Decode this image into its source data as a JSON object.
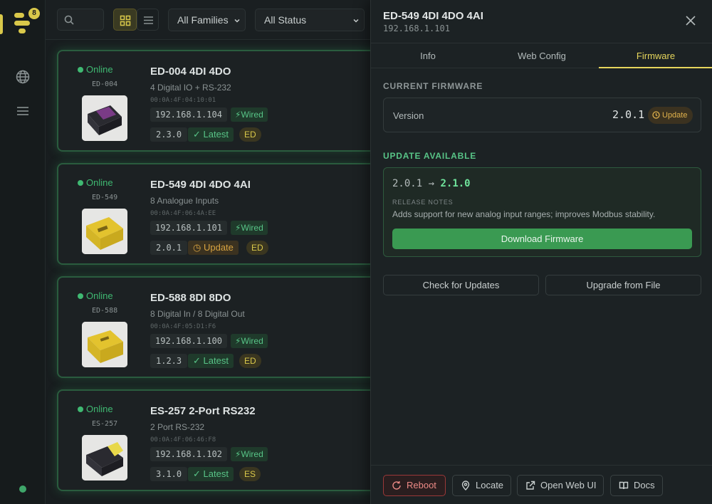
{
  "rail": {
    "badge_count": "8"
  },
  "toolbar": {
    "families_select": "All Families",
    "status_select": "All Status"
  },
  "devices": [
    {
      "status": "Online",
      "model": "ED-004",
      "name": "ED-004 4DI 4DO",
      "description": "4 Digital IO + RS-232",
      "mac": "00:0A:4F:04:10:01",
      "ip": "192.168.1.104",
      "connection": "Wired",
      "version": "2.3.0",
      "fw_state": "Latest",
      "family": "ED"
    },
    {
      "status": "Online",
      "model": "ED-549",
      "name": "ED-549 4DI 4DO 4AI",
      "description": "8 Analogue Inputs",
      "mac": "00:0A:4F:06:4A:EE",
      "ip": "192.168.1.101",
      "connection": "Wired",
      "version": "2.0.1",
      "fw_state": "Update",
      "family": "ED"
    },
    {
      "status": "Online",
      "model": "ED-588",
      "name": "ED-588 8DI 8DO",
      "description": "8 Digital In / 8 Digital Out",
      "mac": "00:0A:4F:05:D1:F6",
      "ip": "192.168.1.100",
      "connection": "Wired",
      "version": "1.2.3",
      "fw_state": "Latest",
      "family": "ED"
    },
    {
      "status": "Online",
      "model": "ES-257",
      "name": "ES-257 2-Port RS232",
      "description": "2 Port RS-232",
      "mac": "00:0A:4F:06:46:F8",
      "ip": "192.168.1.102",
      "connection": "Wired",
      "version": "3.1.0",
      "fw_state": "Latest",
      "family": "ES"
    }
  ],
  "panel": {
    "title": "ED-549 4DI 4DO 4AI",
    "ip": "192.168.1.101",
    "tabs": [
      "Info",
      "Web Config",
      "Firmware"
    ],
    "active_tab": "Firmware",
    "current_firmware": {
      "heading": "CURRENT FIRMWARE",
      "label": "Version",
      "value": "2.0.1",
      "pill": "Update"
    },
    "update_available": {
      "heading": "UPDATE AVAILABLE",
      "from": "2.0.1",
      "arrow": "→",
      "to": "2.1.0",
      "notes_heading": "RELEASE NOTES",
      "notes": "Adds support for new analog input ranges; improves Modbus stability.",
      "download_label": "Download Firmware"
    },
    "actions": {
      "check": "Check for Updates",
      "upgrade": "Upgrade from File"
    },
    "footer": {
      "reboot": "Reboot",
      "locate": "Locate",
      "open_web_ui": "Open Web UI",
      "docs": "Docs"
    }
  },
  "colors": {
    "accent": "#e6d65c",
    "online": "#3fb972",
    "update": "#d9a441",
    "download": "#3a9a52",
    "danger": "#ec8a86"
  },
  "icons": [
    "logo-icon",
    "globe-icon",
    "menu-icon",
    "search-icon",
    "grid-icon",
    "list-icon",
    "chevron-down-icon",
    "plug-icon",
    "check-icon",
    "clock-icon",
    "close-icon",
    "refresh-icon",
    "pin-icon",
    "external-link-icon",
    "book-icon"
  ]
}
